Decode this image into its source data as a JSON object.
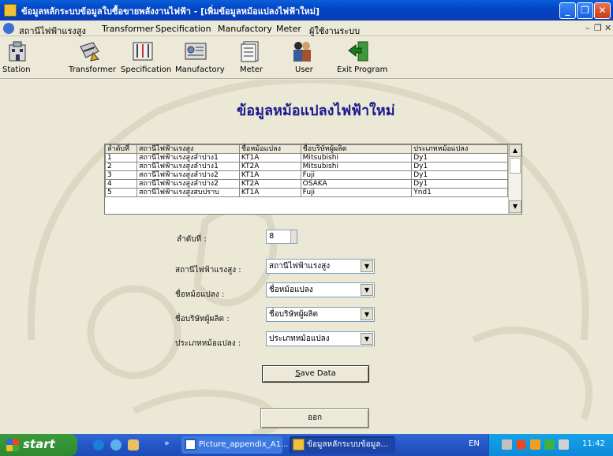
{
  "window": {
    "title": "ข้อมูลหลักระบบข้อมูลใบซื้อขายพลังงานไฟฟ้า - [เพิ่มข้อมูลหม้อแปลงไฟฟ้าใหม่]",
    "min": "_",
    "max": "❐",
    "close": "✕"
  },
  "menu": {
    "items": [
      "สถานีไฟฟ้าแรงสูง",
      "Transformer",
      "Specification",
      "Manufactory",
      "Meter",
      "ผู้ใช้งานระบบ"
    ],
    "mdi_min": "–",
    "mdi_restore": "❐",
    "mdi_close": "✕"
  },
  "toolbar": {
    "buttons": [
      {
        "label": "Station",
        "icon": "building-icon"
      },
      {
        "label": "Transformer",
        "icon": "transformer-icon"
      },
      {
        "label": "Specification",
        "icon": "specification-icon"
      },
      {
        "label": "Manufactory",
        "icon": "manufactory-icon"
      },
      {
        "label": "Meter",
        "icon": "meter-icon"
      },
      {
        "label": "User",
        "icon": "user-icon"
      },
      {
        "label": "Exit Program",
        "icon": "exit-icon"
      }
    ]
  },
  "form": {
    "heading": "ข้อมูลหม้อแปลงไฟฟ้าใหม่",
    "table": {
      "columns": [
        "ลำดับที่",
        "สถานีไฟฟ้าแรงสูง",
        "ชื่อหม้อแปลง",
        "ชื่อบริษัทผู้ผลิต",
        "ประเภทหม้อแปลง"
      ],
      "rows": [
        [
          "1",
          "สถานีไฟฟ้าแรงสูงลำปาง1",
          "KT1A",
          "Mitsubishi",
          "Dy1"
        ],
        [
          "2",
          "สถานีไฟฟ้าแรงสูงลำปาง1",
          "KT2A",
          "Mitsubishi",
          "Dy1"
        ],
        [
          "3",
          "สถานีไฟฟ้าแรงสูงลำปาง2",
          "KT1A",
          "Fuji",
          "Dy1"
        ],
        [
          "4",
          "สถานีไฟฟ้าแรงสูงลำปาง2",
          "KT2A",
          "OSAKA",
          "Dy1"
        ],
        [
          "5",
          "สถานีไฟฟ้าแรงสูงสบปราบ",
          "KT1A",
          "Fuji",
          "Ynd1"
        ]
      ]
    },
    "fields": {
      "seq_label": "ลำดับที่ :",
      "seq_value": "8",
      "station_label": "สถานีไฟฟ้าแรงสูง :",
      "station_value": "สถานีไฟฟ้าแรงสูง",
      "transformer_label": "ชื่อหม้อแปลง :",
      "transformer_value": "ชื่อหม้อแปลง",
      "maker_label": "ชื่อบริษัทผู้ผลิต :",
      "maker_value": "ชื่อบริษัทผู้ผลิต",
      "type_label": "ประเภทหม้อแปลง :",
      "type_value": "ประเภทหม้อแปลง"
    },
    "save_prefix": "",
    "save_mnemonic": "S",
    "save_rest": "ave Data",
    "exit_label": "ออก"
  },
  "taskbar": {
    "start": "start",
    "chevron": "»",
    "tasks": [
      "Picture_appendix_A1...",
      "ข้อมูลหลักระบบข้อมูล..."
    ],
    "lang": "EN",
    "clock": "11:42"
  },
  "colors": {
    "titlebar": "#0a4fd0",
    "heading": "#1a1a8c",
    "taskbar": "#2456c6",
    "start": "#2f8a2f"
  }
}
